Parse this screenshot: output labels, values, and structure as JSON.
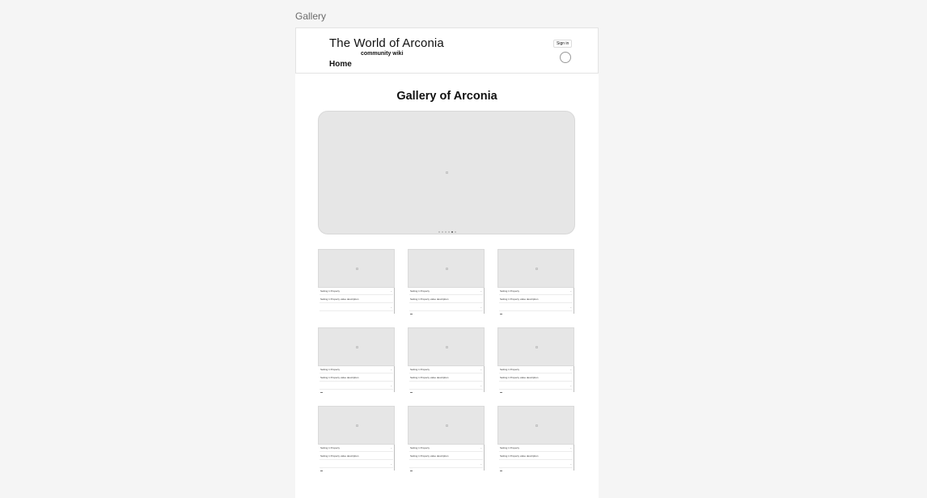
{
  "canvas": {
    "frame_label": "Gallery"
  },
  "header": {
    "title": "The World of Arconia",
    "subtitle": "community wiki",
    "nav_home": "Home",
    "signin_label": "Sign in"
  },
  "main": {
    "title": "Gallery of Arconia",
    "carousel": {
      "slide_count": 6,
      "active_index": 4
    }
  },
  "cards": [
    {
      "label": "Setting 1 Property",
      "description": "Setting 1 Property value description"
    },
    {
      "label": "Setting 1 Property",
      "description": "Setting 1 Property value description"
    },
    {
      "label": "Setting 1 Property",
      "description": "Setting 1 Property value description"
    },
    {
      "label": "Setting 1 Property",
      "description": "Setting 1 Property value description"
    },
    {
      "label": "Setting 1 Property",
      "description": "Setting 1 Property value description"
    },
    {
      "label": "Setting 1 Property",
      "description": "Setting 1 Property value description"
    },
    {
      "label": "Setting 1 Property",
      "description": "Setting 1 Property value description"
    },
    {
      "label": "Setting 1 Property",
      "description": "Setting 1 Property value description"
    },
    {
      "label": "Setting 1 Property",
      "description": "Setting 1 Property value description"
    }
  ],
  "colors": {
    "page_bg": "#f5f5f5",
    "frame_bg": "#ffffff",
    "placeholder": "#e6e6e6",
    "text": "#111111"
  }
}
